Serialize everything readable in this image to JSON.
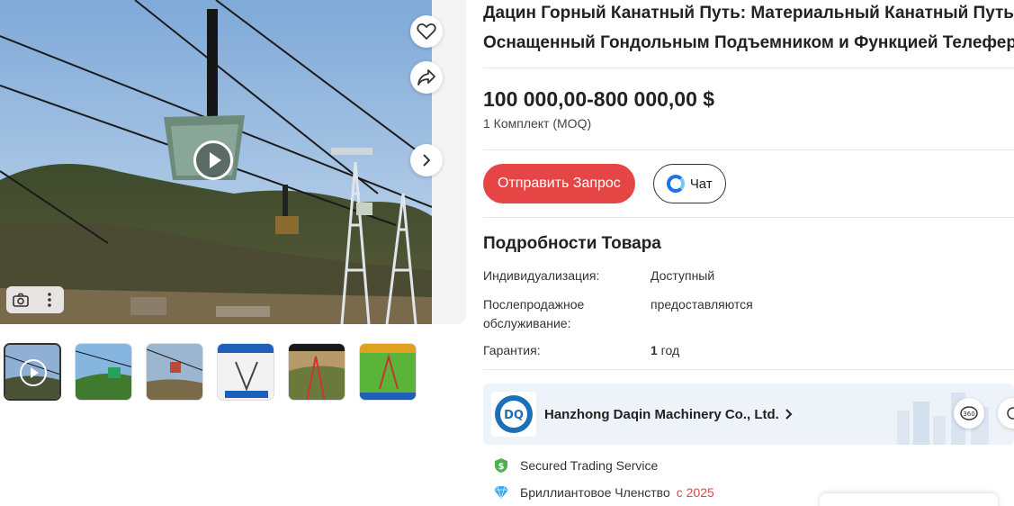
{
  "product": {
    "title_line1": "Дацин Горный Канатный Путь: Материальный Канатный Путь,",
    "title_line2": "Оснащенный Гондольным Подъемником и Функцией Телеферика",
    "price": "100 000,00-800 000,00 $",
    "moq": "1 Комплект (MOQ)"
  },
  "gallery": {
    "icons": {
      "favorite": "heart-icon",
      "share": "share-icon",
      "next": "chevron-right-icon",
      "play": "play-icon",
      "image_search": "camera-icon",
      "more": "more-vertical-icon"
    },
    "thumbnails": [
      {
        "kind": "video",
        "active": true
      },
      {
        "kind": "image",
        "active": false
      },
      {
        "kind": "image",
        "active": false
      },
      {
        "kind": "image",
        "active": false
      },
      {
        "kind": "image",
        "active": false
      },
      {
        "kind": "image",
        "active": false
      }
    ]
  },
  "actions": {
    "inquiry_label": "Отправить Запрос",
    "chat_label": "Чат",
    "inquiry_color": "#e64545"
  },
  "details": {
    "heading": "Подробности Товара",
    "specs": [
      {
        "key": "Индивидуализация:",
        "value": "Доступный"
      },
      {
        "key": "Послепродажное обслуживание:",
        "value": "предоставляются"
      },
      {
        "key": "Гарантия:",
        "value_strong": "1",
        "value_rest": " год"
      }
    ]
  },
  "supplier": {
    "name": "Hanzhong Daqin Machinery Co., Ltd.",
    "badges": [
      {
        "icon": "shield-dollar-icon",
        "label": "Secured Trading Service"
      },
      {
        "icon": "diamond-icon",
        "label": "Бриллиантовое Членство",
        "since": "с 2025"
      }
    ]
  }
}
